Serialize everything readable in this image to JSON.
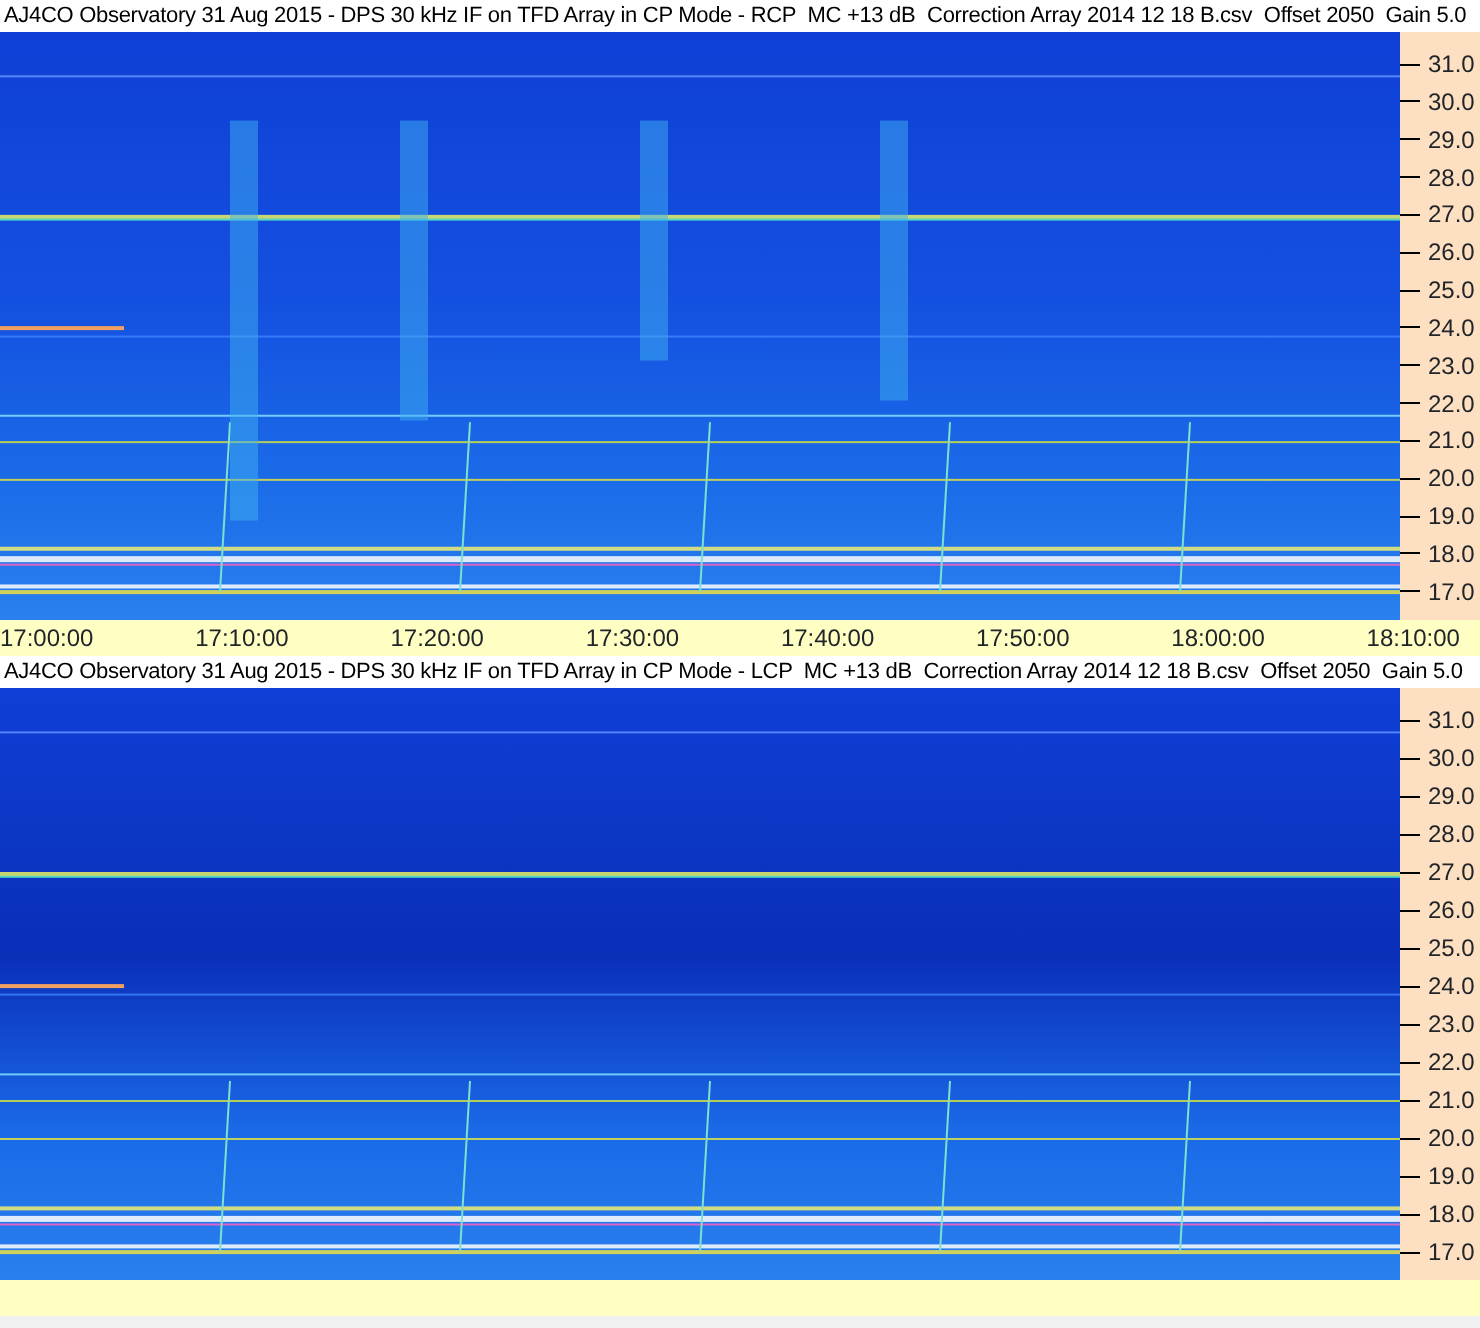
{
  "panels": [
    {
      "title": "AJ4CO Observatory 31 Aug 2015 - DPS 30 kHz IF on TFD Array in CP Mode - RCP  MC +13 dB  Correction Array 2014 12 18 B.csv  Offset 2050  Gain 5.0",
      "frequency_labels": [
        "31.0",
        "30.0",
        "29.0",
        "28.0",
        "27.0",
        "26.0",
        "25.0",
        "24.0",
        "23.0",
        "22.0",
        "21.0",
        "20.0",
        "19.0",
        "18.0",
        "17.0"
      ],
      "time_labels": [
        "17:00:00",
        "17:10:00",
        "17:20:00",
        "17:30:00",
        "17:40:00",
        "17:50:00",
        "18:00:00",
        "18:10:00"
      ]
    },
    {
      "title": "AJ4CO Observatory 31 Aug 2015 - DPS 30 kHz IF on TFD Array in CP Mode - LCP  MC +13 dB  Correction Array 2014 12 18 B.csv  Offset 2050  Gain 5.0",
      "frequency_labels": [
        "31.0",
        "30.0",
        "29.0",
        "28.0",
        "27.0",
        "26.0",
        "25.0",
        "24.0",
        "23.0",
        "22.0",
        "21.0",
        "20.0",
        "19.0",
        "18.0",
        "17.0"
      ]
    }
  ]
}
